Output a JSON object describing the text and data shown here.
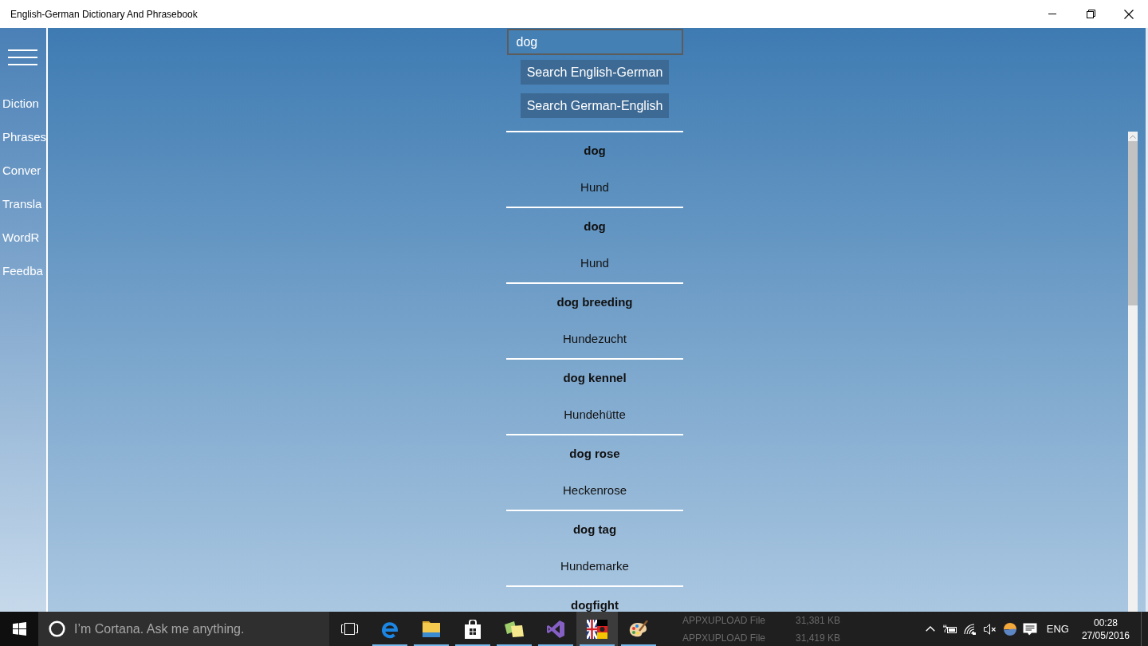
{
  "window": {
    "title": "English-German Dictionary And Phrasebook"
  },
  "sidebar": {
    "items": [
      {
        "label": "Diction"
      },
      {
        "label": "Phrases"
      },
      {
        "label": "Conver"
      },
      {
        "label": "Transla"
      },
      {
        "label": "WordR"
      },
      {
        "label": "Feedba"
      }
    ]
  },
  "search": {
    "value": "dog"
  },
  "buttons": [
    "Search English-German",
    "Search German-English"
  ],
  "results": [
    {
      "term": "dog",
      "translation": "Hund"
    },
    {
      "term": "dog",
      "translation": "Hund"
    },
    {
      "term": "dog breeding",
      "translation": "Hundezucht"
    },
    {
      "term": "dog kennel",
      "translation": "Hundehütte"
    },
    {
      "term": "dog rose",
      "translation": "Heckenrose"
    },
    {
      "term": "dog tag",
      "translation": "Hundemarke"
    },
    {
      "term": "dogfight"
    }
  ],
  "taskbar": {
    "search_placeholder": "I’m Cortana. Ask me anything.",
    "apps": [
      {
        "kind": "letter-e",
        "running": true,
        "active": false
      },
      {
        "kind": "folder",
        "running": true,
        "active": false
      },
      {
        "kind": "bag",
        "running": true,
        "active": false
      },
      {
        "kind": "notes",
        "running": true,
        "active": false
      },
      {
        "kind": "ribbon",
        "running": true,
        "active": false
      },
      {
        "kind": "flag",
        "running": true,
        "active": true
      },
      {
        "kind": "palette",
        "running": true,
        "active": false
      }
    ],
    "background_rows": [
      {
        "type": "APPXUPLOAD File",
        "size": "31,381 KB"
      },
      {
        "type": "APPXUPLOAD File",
        "size": "31,419 KB"
      }
    ],
    "language": "ENG",
    "time": "00:28",
    "date": "27/05/2016"
  }
}
